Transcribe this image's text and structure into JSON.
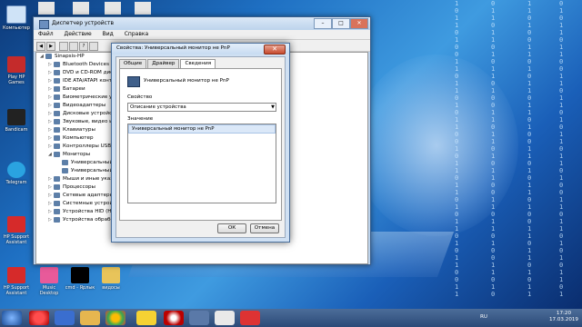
{
  "desktop": {
    "icons": [
      {
        "label": "Компьютер"
      },
      {
        "label": "Play HP Games"
      },
      {
        "label": "Bandicam"
      },
      {
        "label": "Telegram"
      },
      {
        "label": "HP Support Assistant"
      },
      {
        "label": "HP Support Assistant"
      },
      {
        "label": "Music Desktop"
      },
      {
        "label": "cmd - Ярлык"
      },
      {
        "label": "видосы"
      }
    ]
  },
  "device_manager": {
    "title": "Диспетчер устройств",
    "menu": [
      "Файл",
      "Действие",
      "Вид",
      "Справка"
    ],
    "tree": [
      {
        "label": "Sinapsis-HP",
        "level": 0
      },
      {
        "label": "Bluetooth Devices",
        "level": 1
      },
      {
        "label": "DVD и CD-ROM дисководы",
        "level": 1
      },
      {
        "label": "IDE ATA/ATAPI контроллеры",
        "level": 1
      },
      {
        "label": "Батареи",
        "level": 1
      },
      {
        "label": "Биометрические устройства",
        "level": 1
      },
      {
        "label": "Видеоадаптеры",
        "level": 1
      },
      {
        "label": "Дисковые устройства",
        "level": 1
      },
      {
        "label": "Звуковые, видео и игровые устройства",
        "level": 1
      },
      {
        "label": "Клавиатуры",
        "level": 1
      },
      {
        "label": "Компьютер",
        "level": 1
      },
      {
        "label": "Контроллеры USB",
        "level": 1
      },
      {
        "label": "Мониторы",
        "level": 1
      },
      {
        "label": "Универсальный монитор не PnP",
        "level": 2
      },
      {
        "label": "Универсальный монитор не PnP",
        "level": 2
      },
      {
        "label": "Мыши и иные указывающие устройства",
        "level": 1
      },
      {
        "label": "Процессоры",
        "level": 1
      },
      {
        "label": "Сетевые адаптеры",
        "level": 1
      },
      {
        "label": "Системные устройства",
        "level": 1
      },
      {
        "label": "Устройства HID (Human Interface Devices)",
        "level": 1
      },
      {
        "label": "Устройства обработки изображений",
        "level": 1
      }
    ]
  },
  "dialog": {
    "title": "Свойства: Универсальный монитор не PnP",
    "tabs": [
      "Общие",
      "Драйвер",
      "Сведения"
    ],
    "active_tab": "Сведения",
    "device_name": "Универсальный монитор не PnP",
    "property_label": "Свойство",
    "property_value": "Описание устройства",
    "value_label": "Значение",
    "value_item": "Универсальный монитор не PnP",
    "ok_label": "ОК",
    "cancel_label": "Отмена"
  },
  "taskbar": {
    "lang": "RU",
    "time": "17:20",
    "date": "17.03.2019"
  },
  "colors": {
    "taskbar": "#2b4a78",
    "window_frame": "#bcd3ec",
    "close_red": "#c74a2e"
  }
}
